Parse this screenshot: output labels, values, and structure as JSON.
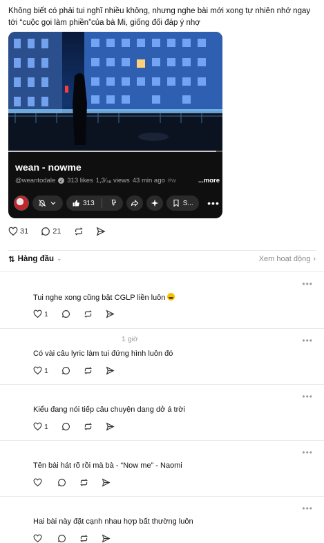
{
  "post": {
    "text": "Không biết có phải tui nghĩ nhiều không, nhưng nghe bài mới xong tự nhiên nhớ ngay tới “cuộc gọi làm phiền”của bà Mi, giống đối đáp ý nhợ"
  },
  "video": {
    "title": "wean - nowme",
    "channel": "@weantodale",
    "likes": "313 likes",
    "views": "1,3⁄₄₈ views",
    "time": "43 min ago",
    "hashtag": "#w",
    "more": "...more",
    "progress": 0.97,
    "like_count": "313",
    "save_label": "S...",
    "channel_avatar_icon": "channel-avatar-icon"
  },
  "post_actions": {
    "likes": "31",
    "comments": "21"
  },
  "sort": {
    "label": "Hàng đầu",
    "view_activity": "Xem hoạt động"
  },
  "comments": [
    {
      "time": "",
      "text": "Tui nghe xong cũng bật CGLP liền luôn",
      "likes": "1",
      "emoji": true
    },
    {
      "time": "1 giờ",
      "text": "Có vài câu lyric làm tui đứng hình luôn đó",
      "likes": "1",
      "emoji": false
    },
    {
      "time": "",
      "text": "Kiểu đang nói tiếp câu chuyện dang dở á trời",
      "likes": "1",
      "emoji": false
    },
    {
      "time": "",
      "text": "Tên bài hát rõ rồi mà bà - “Now me” - Naomi",
      "likes": "",
      "emoji": false
    },
    {
      "time": "",
      "text": "Hai bài này đặt cạnh nhau hợp bất thường luôn",
      "likes": "",
      "emoji": false
    }
  ],
  "colors": {
    "card_bg": "#0f0f0f",
    "pill_bg": "#2b2b2b",
    "divider": "#e9e9e9",
    "muted": "#999999"
  }
}
